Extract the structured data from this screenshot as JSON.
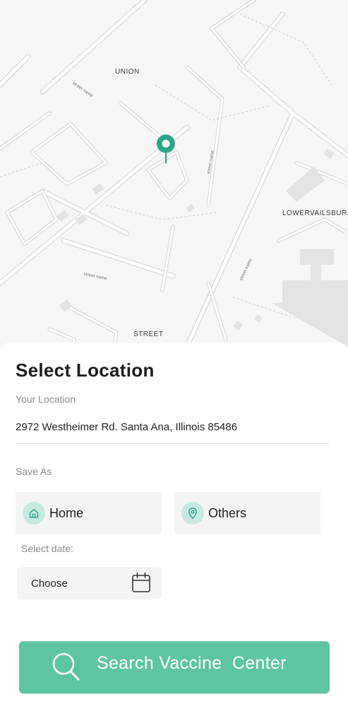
{
  "map": {
    "labels": {
      "union": "UNION",
      "lowervailsburg": "LOWERVAILSBUR",
      "street": "STREET",
      "street_name": "street name"
    }
  },
  "sheet": {
    "title": "Select Location",
    "location_label": "Your Location",
    "address": "2972 Westheimer Rd. Santa Ana, Illinois 85486",
    "save_as_label": "Save As",
    "options": [
      {
        "label": "Home",
        "icon": "home-icon"
      },
      {
        "label": "Others",
        "icon": "location-pin-icon"
      }
    ],
    "date_label": "Select date:",
    "date_value": "Choose",
    "search_button": "Search Vaccine  Center"
  },
  "colors": {
    "accent": "#5ec5a2",
    "pin": "#2ba78a",
    "icon_bg": "#c7e9df",
    "option_bg": "#f4f4f4"
  }
}
